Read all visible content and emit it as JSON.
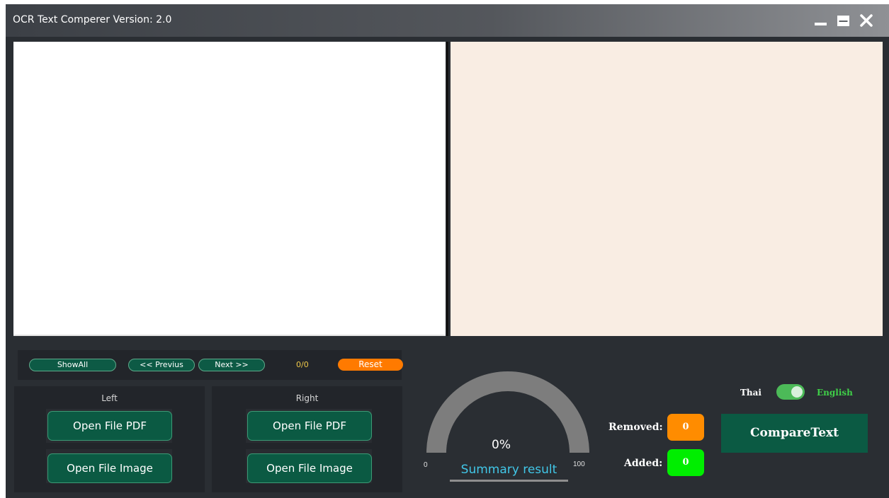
{
  "window": {
    "title": "OCR Text Comperer Version: 2.0"
  },
  "navigation": {
    "show_all": "ShowAll",
    "previous": "<< Previus",
    "next": "Next >>",
    "counter": "0/0",
    "reset": "Reset"
  },
  "left_panel": {
    "label": "Left",
    "open_pdf": "Open File PDF",
    "open_image": "Open File Image"
  },
  "right_panel": {
    "label": "Right",
    "open_pdf": "Open File PDF",
    "open_image": "Open File Image"
  },
  "gauge": {
    "percent_text": "0%",
    "value_percent": 0,
    "min": "0",
    "max": "100",
    "caption": "Summary result"
  },
  "stats": {
    "removed_label": "Removed:",
    "removed_value": "0",
    "added_label": "Added:",
    "added_value": "0"
  },
  "language": {
    "left": "Thai",
    "right": "English",
    "selected": "English"
  },
  "compare_button": "CompareText",
  "colors": {
    "accent_green": "#0b5a43",
    "reset_orange": "#ff7a00",
    "removed_orange": "#ff8c00",
    "added_green": "#00ee00",
    "summary_cyan": "#41c7e8",
    "counter_yellow": "#f0c94a",
    "right_pane_bg": "#f9ede3"
  }
}
